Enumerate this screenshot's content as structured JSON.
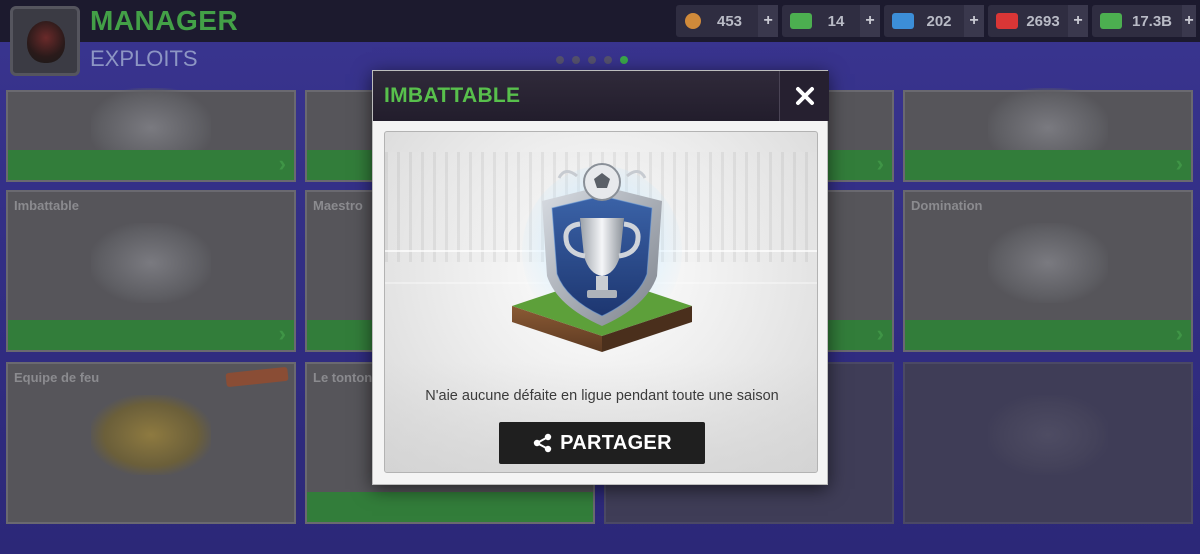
{
  "header": {
    "title": "MANAGER",
    "subtitle": "EXPLOITS"
  },
  "currencies": [
    {
      "name": "tokens",
      "icon": "token-coin-icon",
      "value": "453",
      "color": "#d08a3a"
    },
    {
      "name": "training",
      "icon": "training-ticket-icon",
      "value": "14",
      "color": "#4caf50"
    },
    {
      "name": "energy",
      "icon": "energy-bolt-icon",
      "value": "202",
      "color": "#3c8ed8"
    },
    {
      "name": "health",
      "icon": "medical-cross-icon",
      "value": "2693",
      "color": "#d93636"
    },
    {
      "name": "money",
      "icon": "money-bill-icon",
      "value": "17.3B",
      "color": "#4caf50"
    }
  ],
  "pager": {
    "pages": 5,
    "active": 5
  },
  "cards": [
    {
      "label": ""
    },
    {
      "label": ""
    },
    {
      "label": ""
    },
    {
      "label": ""
    },
    {
      "label": "Imbattable"
    },
    {
      "label": "Maestro"
    },
    {
      "label": ""
    },
    {
      "label": "Domination"
    },
    {
      "label": "Equipe de feu"
    },
    {
      "label": "Le tonton"
    },
    {
      "label": ""
    },
    {
      "label": ""
    }
  ],
  "modal": {
    "title": "IMBATTABLE",
    "description": "N'aie aucune défaite en ligue pendant toute une saison",
    "share_label": "PARTAGER"
  },
  "colors": {
    "accent_green": "#58c04c",
    "modal_header": "#221d2c",
    "button_bg": "#1f1f1f"
  }
}
